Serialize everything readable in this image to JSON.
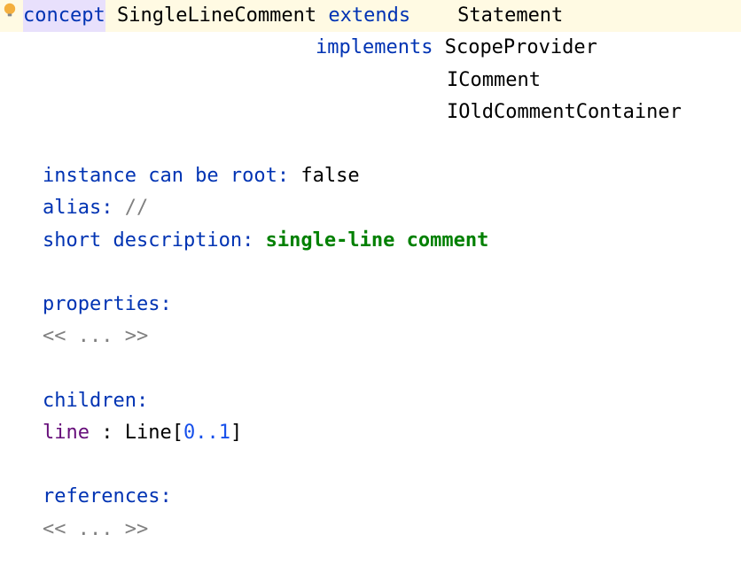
{
  "header": {
    "concept_kw": "concept",
    "concept_name": "SingleLineComment",
    "extends_kw": "extends",
    "extends_type": "Statement",
    "implements_kw": "implements",
    "implements_types": [
      "ScopeProvider",
      "IComment",
      "IOldCommentContainer"
    ]
  },
  "fields": {
    "instance_root_label": "instance can be root:",
    "instance_root_value": "false",
    "alias_label": "alias:",
    "alias_value": "//",
    "short_desc_label": "short description:",
    "short_desc_value": "single-line comment",
    "properties_label": "properties:",
    "properties_placeholder": "<< ... >>",
    "children_label": "children:",
    "child_name": "line",
    "child_sep": " : ",
    "child_type": "Line",
    "child_card_open": "[",
    "child_card": "0..1",
    "child_card_close": "]",
    "references_label": "references:",
    "references_placeholder": "<< ... >>"
  }
}
